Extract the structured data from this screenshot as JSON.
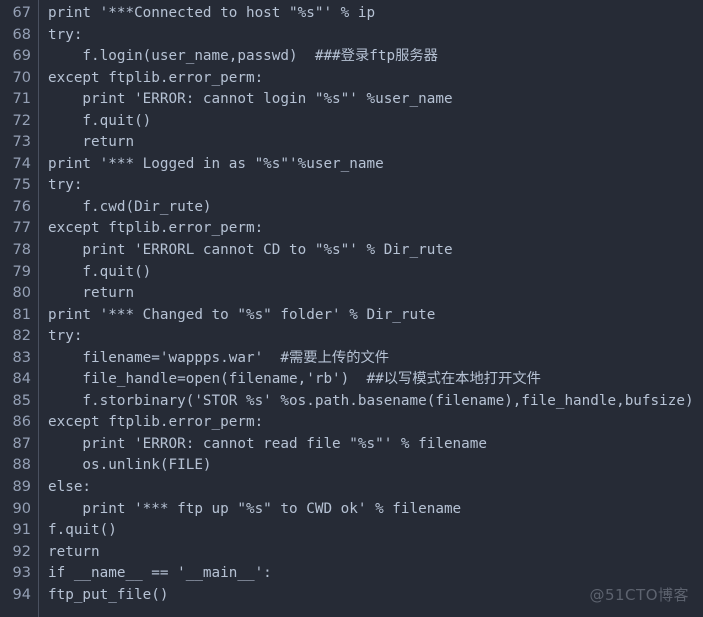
{
  "editor": {
    "language": "python",
    "theme": "dark",
    "background_color": "#262b36",
    "text_color": "#b6c2d4",
    "gutter_color": "#95a0b5",
    "first_line_number": 67,
    "last_line_number": 94,
    "lines": [
      {
        "number": "67",
        "text": "print '***Connected to host \"%s\"' % ip"
      },
      {
        "number": "68",
        "text": "try:"
      },
      {
        "number": "69",
        "text": "    f.login(user_name,passwd)  ###登录ftp服务器"
      },
      {
        "number": "70",
        "text": "except ftplib.error_perm:"
      },
      {
        "number": "71",
        "text": "    print 'ERROR: cannot login \"%s\"' %user_name"
      },
      {
        "number": "72",
        "text": "    f.quit()"
      },
      {
        "number": "73",
        "text": "    return"
      },
      {
        "number": "74",
        "text": "print '*** Logged in as \"%s\"'%user_name"
      },
      {
        "number": "75",
        "text": "try:"
      },
      {
        "number": "76",
        "text": "    f.cwd(Dir_rute)"
      },
      {
        "number": "77",
        "text": "except ftplib.error_perm:"
      },
      {
        "number": "78",
        "text": "    print 'ERRORL cannot CD to \"%s\"' % Dir_rute"
      },
      {
        "number": "79",
        "text": "    f.quit()"
      },
      {
        "number": "80",
        "text": "    return"
      },
      {
        "number": "81",
        "text": "print '*** Changed to \"%s\" folder' % Dir_rute"
      },
      {
        "number": "82",
        "text": "try:"
      },
      {
        "number": "83",
        "text": "    filename='wappps.war'  #需要上传的文件"
      },
      {
        "number": "84",
        "text": "    file_handle=open(filename,'rb')  ##以写模式在本地打开文件"
      },
      {
        "number": "85",
        "text": "    f.storbinary('STOR %s' %os.path.basename(filename),file_handle,bufsize)  #传一个"
      },
      {
        "number": "86",
        "text": "except ftplib.error_perm:"
      },
      {
        "number": "87",
        "text": "    print 'ERROR: cannot read file \"%s\"' % filename"
      },
      {
        "number": "88",
        "text": "    os.unlink(FILE)"
      },
      {
        "number": "89",
        "text": "else:"
      },
      {
        "number": "90",
        "text": "    print '*** ftp up \"%s\" to CWD ok' % filename"
      },
      {
        "number": "91",
        "text": "f.quit()"
      },
      {
        "number": "92",
        "text": "return"
      },
      {
        "number": "93",
        "text": "if __name__ == '__main__':"
      },
      {
        "number": "94",
        "text": "ftp_put_file()"
      }
    ]
  },
  "watermark": {
    "text": "@51CTO博客"
  }
}
